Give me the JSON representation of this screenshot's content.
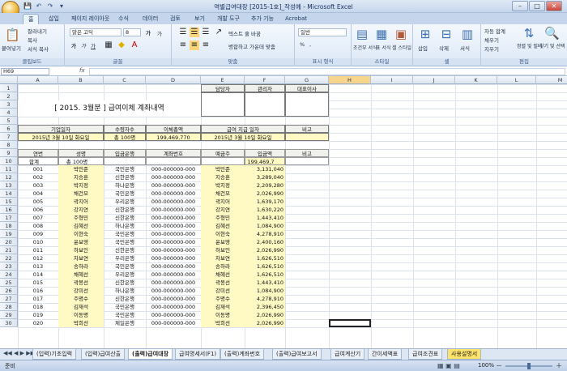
{
  "window": {
    "title": "역별급여대장 [2015-1호]_작성예 - Microsoft Excel",
    "min": "–",
    "max": "□",
    "close": "✕"
  },
  "qat": [
    "💾",
    "↶",
    "↷",
    "▾"
  ],
  "ribbon_tabs": [
    "홈",
    "삽입",
    "페이지 레이아웃",
    "수식",
    "데이터",
    "검토",
    "보기",
    "개발 도구",
    "추가 기능",
    "Acrobat"
  ],
  "ribbon": {
    "clipboard": {
      "label": "클립보드",
      "paste": "붙여넣기",
      "cut": "잘라내기",
      "copy": "복사",
      "format_painter": "서식 복사"
    },
    "font": {
      "label": "글꼴",
      "name": "맑은 고딕",
      "size": "8",
      "grow": "가",
      "shrink": "가",
      "bold": "가",
      "italic": "가",
      "underline": "가"
    },
    "align": {
      "label": "맞춤",
      "wrap": "텍스트 줄 바꿈",
      "merge": "병합하고 가운데 맞춤"
    },
    "number": {
      "label": "표시 형식",
      "format": "일반",
      "percent": "%",
      "comma": ","
    },
    "styles": {
      "label": "스타일",
      "cond": "조건부 서식",
      "table": "표 서식",
      "cell": "셀 스타일"
    },
    "cells": {
      "label": "셀",
      "insert": "삽입",
      "delete": "삭제",
      "format": "서식"
    },
    "editing": {
      "label": "편집",
      "autosum": "자동 합계",
      "fill": "채우기",
      "clear": "지우기",
      "sort": "정렬 및 필터",
      "find": "찾기 및 선택"
    }
  },
  "formula_bar": {
    "cell": "H69",
    "fx": "fx",
    "value": ""
  },
  "columns": [
    "A",
    "B",
    "C",
    "D",
    "E",
    "F",
    "G",
    "H",
    "I",
    "J",
    "K",
    "L",
    "M"
  ],
  "rows": [
    "1",
    "2",
    "3",
    "4",
    "5",
    "6",
    "7",
    "8",
    "9",
    "10",
    "11",
    "12",
    "13",
    "14",
    "15",
    "16",
    "17",
    "18",
    "19",
    "20",
    "21",
    "22",
    "23",
    "24",
    "25",
    "26",
    "27",
    "28",
    "29",
    "30"
  ],
  "sheet": {
    "title": "[ 2015. 3월분 ]  급여이체 계좌내역",
    "approval": [
      "담당자",
      "관리자",
      "대표이사"
    ],
    "summary_header": [
      "기업일자",
      "수령자수",
      "이체총액",
      "급여 지급 일자",
      "비고"
    ],
    "summary_values": [
      "2015년 3월 10일 화요일",
      "총 100명",
      "199,469,770",
      "2015년 3월 10일 화요일",
      ""
    ],
    "list_header": [
      "연번",
      "성명",
      "입금은행",
      "계좌번호",
      "예금주",
      "입금액",
      "비고"
    ],
    "filter_row": [
      "합계",
      "총 100명",
      "",
      "",
      "",
      "199,469,7",
      ""
    ],
    "records": [
      [
        "001",
        "박민준",
        "국민은행",
        "000-000000-000",
        "박민준",
        "3,131,040"
      ],
      [
        "002",
        "지승훈",
        "신한은행",
        "000-000000-000",
        "지승훈",
        "3,289,040"
      ],
      [
        "003",
        "박지정",
        "하나은행",
        "000-000000-000",
        "박지정",
        "2,209,280"
      ],
      [
        "004",
        "채건모",
        "국민은행",
        "000-000000-000",
        "채건모",
        "2,026,990"
      ],
      [
        "005",
        "곽지어",
        "우리은행",
        "000-000000-000",
        "곽지어",
        "1,639,170"
      ],
      [
        "006",
        "강지연",
        "신한은행",
        "000-000000-000",
        "강지연",
        "1,630,220"
      ],
      [
        "007",
        "주형민",
        "신한은행",
        "000-000000-000",
        "주형민",
        "1,443,410"
      ],
      [
        "008",
        "김혜선",
        "하나은행",
        "000-000000-000",
        "김혜선",
        "1,084,900"
      ],
      [
        "009",
        "이현숙",
        "국민은행",
        "000-000000-000",
        "이현숙",
        "4,278,910"
      ],
      [
        "010",
        "윤보영",
        "국민은행",
        "000-000000-000",
        "윤보영",
        "2,400,160"
      ],
      [
        "011",
        "하보인",
        "신한은행",
        "000-000000-000",
        "하보인",
        "2,026,990"
      ],
      [
        "012",
        "차보연",
        "우리은행",
        "000-000000-000",
        "차보연",
        "1,626,510"
      ],
      [
        "013",
        "송하라",
        "국민은행",
        "000-000000-000",
        "송하라",
        "1,626,510"
      ],
      [
        "014",
        "채혜선",
        "우리은행",
        "000-000000-000",
        "채혜선",
        "1,626,510"
      ],
      [
        "015",
        "곽봉선",
        "신한은행",
        "000-000000-000",
        "곽봉선",
        "1,443,410"
      ],
      [
        "016",
        "강미선",
        "하나은행",
        "000-000000-000",
        "강미선",
        "1,084,900"
      ],
      [
        "017",
        "주명수",
        "신한은행",
        "000-000000-000",
        "주명수",
        "4,278,910"
      ],
      [
        "018",
        "김재석",
        "국민은행",
        "000-000000-000",
        "김재석",
        "2,396,450"
      ],
      [
        "019",
        "이동명",
        "국민은행",
        "000-000000-000",
        "이동명",
        "2,026,990"
      ],
      [
        "020",
        "박희선",
        "제일은행",
        "000-000000-000",
        "박희선",
        "2,026,990"
      ]
    ]
  },
  "sheet_tabs": [
    "(입력)기초입력",
    "(입력)급여산출",
    "(출력)급여대장",
    "급여명세서(F1)",
    "(출력)계좌번호",
    "(출력)급여보고서",
    "급여계산기",
    "간이세액표",
    "급여조견표",
    "사용설명서"
  ],
  "status": {
    "ready": "준비",
    "zoom": "100%",
    "minus": "－",
    "plus": "＋"
  },
  "colors": {
    "highlight_yellow": "#fff9c4",
    "selected_header": "#f7d58d",
    "active_tab_accent": "#ffe36b"
  }
}
